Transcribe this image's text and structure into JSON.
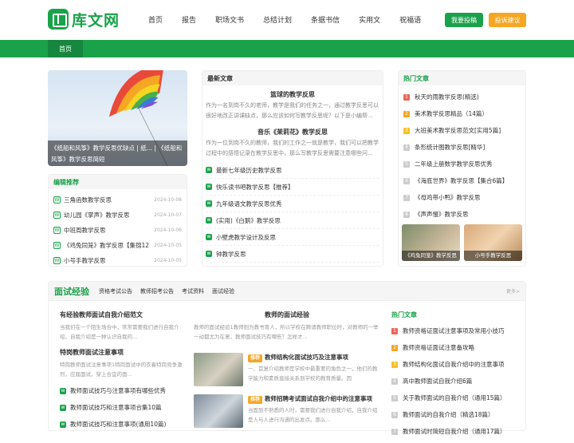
{
  "logo": {
    "text": "库文网"
  },
  "nav": [
    "首页",
    "报告",
    "职场文书",
    "总结计划",
    "条据书信",
    "实用文",
    "祝福语"
  ],
  "header_buttons": {
    "post": "我要投稿",
    "report": "投诉建议"
  },
  "home_tab": "首页",
  "banner": {
    "caption": "《纸船和风筝》教学反思优缺点 | 纸... | 《纸船和风筝》教学反思简短"
  },
  "editor_pick": {
    "title": "编辑推荐",
    "items": [
      {
        "title": "三角函数教学反思",
        "date": "2024-10-08"
      },
      {
        "title": "幼儿园《掌声》教学反思",
        "date": "2024-10-07"
      },
      {
        "title": "中班周教学反思",
        "date": "2024-10-06"
      },
      {
        "title": "《鸡兔同笼》教学反思【集锦12",
        "date": "2024-10-05"
      },
      {
        "title": "小号手教学反思",
        "date": "2024-10-05"
      }
    ]
  },
  "latest": {
    "title": "最新文章",
    "featured": [
      {
        "title": "篮球的教学反思",
        "excerpt": "作为一名到岗不久的老师，教学是我们的任务之一，通过教学反思可以很好地改正讲课缺点，那么应该如何写教学反思呢？以下是小编帮..."
      },
      {
        "title": "音乐《茉莉花》教学反思",
        "excerpt": "作为一位到岗不久的教师，我们的工作之一就是教学，我们可以把教学过程中的感悟记录在教学反思中，那么写教学反思需要注意哪些问..."
      }
    ],
    "items": [
      "最新七年级历史教学反思",
      "快乐读书吧教学反思【推荐】",
      "九年级语文教学反思优秀",
      "(实用)《白鹅》教学反思",
      "小壁虎教学设计及反思",
      "钟教学反思"
    ]
  },
  "hot": {
    "title": "热门文章",
    "items": [
      "秋天的雨教学反思(精选)",
      "美术教学反思精品（14篇）",
      "大班美术教学反思范文[实用5篇]",
      "条形统计图教学反思[精华]",
      "二年级上册数学教学反思优秀",
      "《海底世界》教学反思【集合6篇】",
      "《母鸡带小鸭》教学反思",
      "《声声慢》教学反思"
    ],
    "thumbs": [
      "《鸡兔同笼》教学反思",
      "小号手教学反思"
    ]
  },
  "interview": {
    "title": "面试经验",
    "tabs": [
      "资格考试公告",
      "教师招考公告",
      "考试资料",
      "面试经验"
    ],
    "more": "更多>",
    "col1": {
      "a1_title": "有经验教师面试自我介绍范文",
      "a1_ex": "当我们在一个陌生场合中，常常需要我们进行自我介绍，自我介绍是一种认识自我的...",
      "a2_title": "特岗教师面试注意事项",
      "a2_ex": "特岗教师面试注意事项1特岗面试中的衣着特岗竞争激烈，应届面试，穿上合宜的面...",
      "items": [
        "教师面试技巧与注意事项有哪些优秀",
        "教师面试技巧和注意事项合集10篇",
        "教师面试技巧和注意事项(通用10篇)"
      ]
    },
    "col2": {
      "title": "教师的面试经验",
      "excerpt": "教师的面试经验1教师则为教书育人，所以学校在聘请教师职位时，对教师的一举一动都尤为在意，教师面试技巧有哪些？怎样才...",
      "cards": [
        {
          "tag": "推荐",
          "title": "教师结构化面试技巧及注意事项",
          "excerpt": "一、首复介绍教师是学校中最重要的角色之一，他们的教学能力和素质直接关系到学校的教育质量。因"
        },
        {
          "tag": "推荐",
          "title": "教师招聘考试面试自我介绍中的注意事项",
          "excerpt": "当面到不熟悉的人时，需要我们进行自我介绍，自我介绍是人与人进行沟通的出发点。那么..."
        }
      ]
    },
    "col3": {
      "title": "热门文章",
      "items": [
        "教师资格证面试注意事项及常用小技巧",
        "教师资格证面试注意备攻略",
        "教师结构化面试自我介绍中的注意事项",
        "高中教师面试自我介绍6篇",
        "关于教师面试的自我介绍（通用15篇）",
        "教师面试的自我介绍（精选18篇）",
        "教师面试时简短自我介绍（通用17篇）"
      ]
    }
  },
  "colors": {
    "brand": "#1aa24b",
    "accent": "#f5a623"
  }
}
